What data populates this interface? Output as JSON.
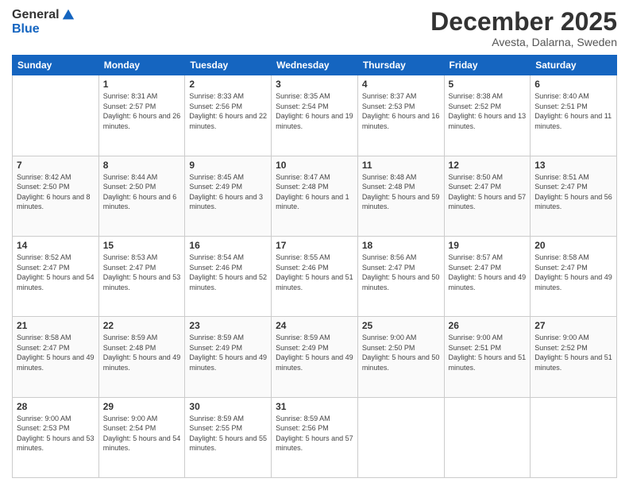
{
  "header": {
    "logo_line1": "General",
    "logo_line2": "Blue",
    "month_title": "December 2025",
    "location": "Avesta, Dalarna, Sweden"
  },
  "weekdays": [
    "Sunday",
    "Monday",
    "Tuesday",
    "Wednesday",
    "Thursday",
    "Friday",
    "Saturday"
  ],
  "weeks": [
    [
      {
        "day": "",
        "sunrise": "",
        "sunset": "",
        "daylight": ""
      },
      {
        "day": "1",
        "sunrise": "Sunrise: 8:31 AM",
        "sunset": "Sunset: 2:57 PM",
        "daylight": "Daylight: 6 hours and 26 minutes."
      },
      {
        "day": "2",
        "sunrise": "Sunrise: 8:33 AM",
        "sunset": "Sunset: 2:56 PM",
        "daylight": "Daylight: 6 hours and 22 minutes."
      },
      {
        "day": "3",
        "sunrise": "Sunrise: 8:35 AM",
        "sunset": "Sunset: 2:54 PM",
        "daylight": "Daylight: 6 hours and 19 minutes."
      },
      {
        "day": "4",
        "sunrise": "Sunrise: 8:37 AM",
        "sunset": "Sunset: 2:53 PM",
        "daylight": "Daylight: 6 hours and 16 minutes."
      },
      {
        "day": "5",
        "sunrise": "Sunrise: 8:38 AM",
        "sunset": "Sunset: 2:52 PM",
        "daylight": "Daylight: 6 hours and 13 minutes."
      },
      {
        "day": "6",
        "sunrise": "Sunrise: 8:40 AM",
        "sunset": "Sunset: 2:51 PM",
        "daylight": "Daylight: 6 hours and 11 minutes."
      }
    ],
    [
      {
        "day": "7",
        "sunrise": "Sunrise: 8:42 AM",
        "sunset": "Sunset: 2:50 PM",
        "daylight": "Daylight: 6 hours and 8 minutes."
      },
      {
        "day": "8",
        "sunrise": "Sunrise: 8:44 AM",
        "sunset": "Sunset: 2:50 PM",
        "daylight": "Daylight: 6 hours and 6 minutes."
      },
      {
        "day": "9",
        "sunrise": "Sunrise: 8:45 AM",
        "sunset": "Sunset: 2:49 PM",
        "daylight": "Daylight: 6 hours and 3 minutes."
      },
      {
        "day": "10",
        "sunrise": "Sunrise: 8:47 AM",
        "sunset": "Sunset: 2:48 PM",
        "daylight": "Daylight: 6 hours and 1 minute."
      },
      {
        "day": "11",
        "sunrise": "Sunrise: 8:48 AM",
        "sunset": "Sunset: 2:48 PM",
        "daylight": "Daylight: 5 hours and 59 minutes."
      },
      {
        "day": "12",
        "sunrise": "Sunrise: 8:50 AM",
        "sunset": "Sunset: 2:47 PM",
        "daylight": "Daylight: 5 hours and 57 minutes."
      },
      {
        "day": "13",
        "sunrise": "Sunrise: 8:51 AM",
        "sunset": "Sunset: 2:47 PM",
        "daylight": "Daylight: 5 hours and 56 minutes."
      }
    ],
    [
      {
        "day": "14",
        "sunrise": "Sunrise: 8:52 AM",
        "sunset": "Sunset: 2:47 PM",
        "daylight": "Daylight: 5 hours and 54 minutes."
      },
      {
        "day": "15",
        "sunrise": "Sunrise: 8:53 AM",
        "sunset": "Sunset: 2:47 PM",
        "daylight": "Daylight: 5 hours and 53 minutes."
      },
      {
        "day": "16",
        "sunrise": "Sunrise: 8:54 AM",
        "sunset": "Sunset: 2:46 PM",
        "daylight": "Daylight: 5 hours and 52 minutes."
      },
      {
        "day": "17",
        "sunrise": "Sunrise: 8:55 AM",
        "sunset": "Sunset: 2:46 PM",
        "daylight": "Daylight: 5 hours and 51 minutes."
      },
      {
        "day": "18",
        "sunrise": "Sunrise: 8:56 AM",
        "sunset": "Sunset: 2:47 PM",
        "daylight": "Daylight: 5 hours and 50 minutes."
      },
      {
        "day": "19",
        "sunrise": "Sunrise: 8:57 AM",
        "sunset": "Sunset: 2:47 PM",
        "daylight": "Daylight: 5 hours and 49 minutes."
      },
      {
        "day": "20",
        "sunrise": "Sunrise: 8:58 AM",
        "sunset": "Sunset: 2:47 PM",
        "daylight": "Daylight: 5 hours and 49 minutes."
      }
    ],
    [
      {
        "day": "21",
        "sunrise": "Sunrise: 8:58 AM",
        "sunset": "Sunset: 2:47 PM",
        "daylight": "Daylight: 5 hours and 49 minutes."
      },
      {
        "day": "22",
        "sunrise": "Sunrise: 8:59 AM",
        "sunset": "Sunset: 2:48 PM",
        "daylight": "Daylight: 5 hours and 49 minutes."
      },
      {
        "day": "23",
        "sunrise": "Sunrise: 8:59 AM",
        "sunset": "Sunset: 2:49 PM",
        "daylight": "Daylight: 5 hours and 49 minutes."
      },
      {
        "day": "24",
        "sunrise": "Sunrise: 8:59 AM",
        "sunset": "Sunset: 2:49 PM",
        "daylight": "Daylight: 5 hours and 49 minutes."
      },
      {
        "day": "25",
        "sunrise": "Sunrise: 9:00 AM",
        "sunset": "Sunset: 2:50 PM",
        "daylight": "Daylight: 5 hours and 50 minutes."
      },
      {
        "day": "26",
        "sunrise": "Sunrise: 9:00 AM",
        "sunset": "Sunset: 2:51 PM",
        "daylight": "Daylight: 5 hours and 51 minutes."
      },
      {
        "day": "27",
        "sunrise": "Sunrise: 9:00 AM",
        "sunset": "Sunset: 2:52 PM",
        "daylight": "Daylight: 5 hours and 51 minutes."
      }
    ],
    [
      {
        "day": "28",
        "sunrise": "Sunrise: 9:00 AM",
        "sunset": "Sunset: 2:53 PM",
        "daylight": "Daylight: 5 hours and 53 minutes."
      },
      {
        "day": "29",
        "sunrise": "Sunrise: 9:00 AM",
        "sunset": "Sunset: 2:54 PM",
        "daylight": "Daylight: 5 hours and 54 minutes."
      },
      {
        "day": "30",
        "sunrise": "Sunrise: 8:59 AM",
        "sunset": "Sunset: 2:55 PM",
        "daylight": "Daylight: 5 hours and 55 minutes."
      },
      {
        "day": "31",
        "sunrise": "Sunrise: 8:59 AM",
        "sunset": "Sunset: 2:56 PM",
        "daylight": "Daylight: 5 hours and 57 minutes."
      },
      {
        "day": "",
        "sunrise": "",
        "sunset": "",
        "daylight": ""
      },
      {
        "day": "",
        "sunrise": "",
        "sunset": "",
        "daylight": ""
      },
      {
        "day": "",
        "sunrise": "",
        "sunset": "",
        "daylight": ""
      }
    ]
  ]
}
